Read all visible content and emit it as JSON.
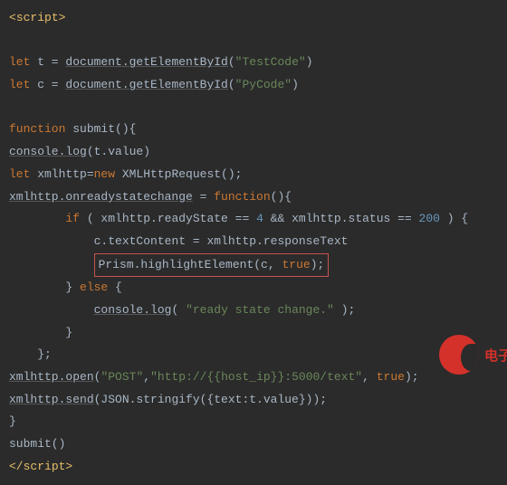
{
  "code": {
    "line0": {
      "open_angle": "<",
      "tag": "script",
      "close_angle": ">"
    },
    "line1": {
      "let": "let",
      "t": " t = ",
      "doc": "document.getElementById",
      "p1": "(",
      "s": "\"TestCode\"",
      "p2": ")"
    },
    "line2": {
      "let": "let",
      "c": " c = ",
      "doc": "document.getElementById",
      "p1": "(",
      "s": "\"PyCode\"",
      "p2": ")"
    },
    "line3": {
      "fn": "function",
      "name": " submit(){"
    },
    "line4": {
      "c": "console.log",
      "p": "(t.value)"
    },
    "line5": {
      "let": "let",
      "x": " xmlhttp=",
      "new": "new",
      "cls": " XMLHttpRequest();"
    },
    "line6": {
      "x": "xmlhttp.onreadystatechange",
      "eq": " = ",
      "fn": "function",
      "rest": "(){"
    },
    "line7": {
      "if": "if",
      "cond1": " ( xmlhttp.readyState == ",
      "n1": "4",
      "and": " && ",
      "cond2": "xmlhttp.status == ",
      "n2": "200",
      "end": " ) {"
    },
    "line8": {
      "txt": "c.textContent = xmlhttp.responseText"
    },
    "line9": {
      "txt": "Prism.highlightElement(c, ",
      "tru": "true",
      "end": ");"
    },
    "line10": {
      "txt": "} ",
      "else": "else",
      " b": " {"
    },
    "line11": {
      "c": "console.log",
      "p1": "( ",
      "s": "\"ready state change.\"",
      "p2": " );"
    },
    "line12": {
      "txt": "}"
    },
    "line13": {
      "txt": "};"
    },
    "line14": {
      "x": "xmlhttp.open",
      "p1": "(",
      "s1": "\"POST\"",
      "c": ",",
      "s2": "\"http://{{host_ip}}:5000/text\"",
      "c2": ", ",
      "tru": "true",
      "p2": ");"
    },
    "line15": {
      "x": "xmlhttp.send",
      "p": "(JSON.stringify({text:t.value}));"
    },
    "line16": {
      "txt": "}"
    },
    "line17": {
      "txt": "submit()"
    },
    "line18": {
      "open": "</",
      "tag": "script",
      "close": ">"
    }
  },
  "watermark": {
    "text": "电子"
  }
}
